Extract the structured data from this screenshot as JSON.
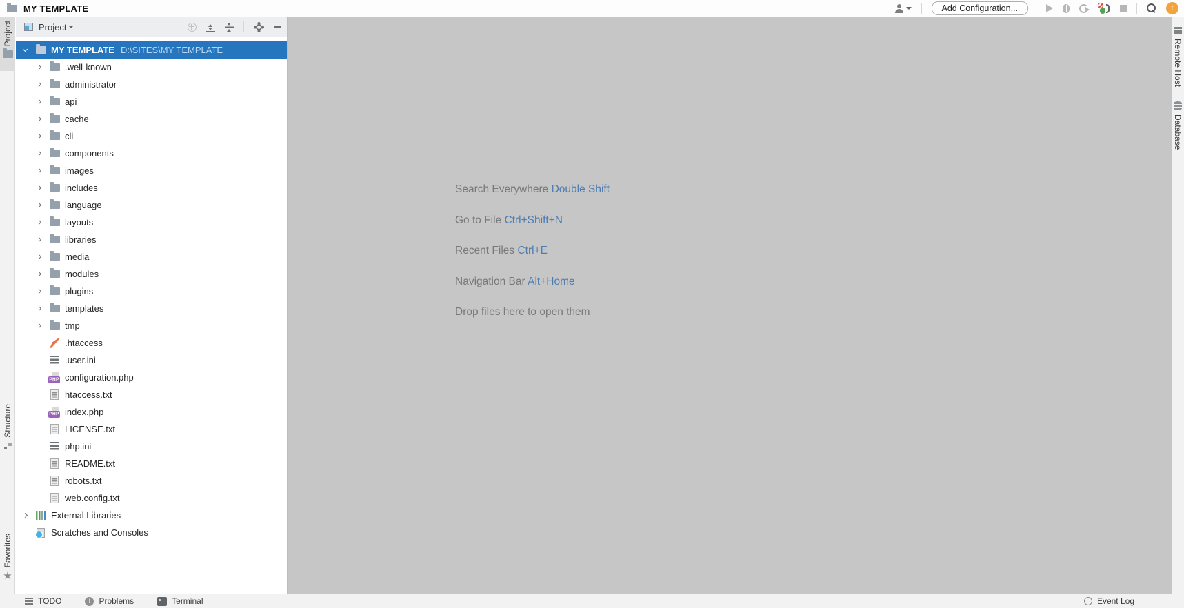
{
  "titlebar": {
    "title": "MY TEMPLATE",
    "add_configuration_label": "Add Configuration..."
  },
  "project_panel": {
    "tab_title": "Project",
    "root": {
      "name": "MY TEMPLATE",
      "path": "D:\\SITES\\MY TEMPLATE"
    },
    "items": [
      {
        "name": ".well-known",
        "icon": "folder",
        "chevron": true,
        "level": 2
      },
      {
        "name": "administrator",
        "icon": "folder",
        "chevron": true,
        "level": 2
      },
      {
        "name": "api",
        "icon": "folder",
        "chevron": true,
        "level": 2
      },
      {
        "name": "cache",
        "icon": "folder",
        "chevron": true,
        "level": 2
      },
      {
        "name": "cli",
        "icon": "folder",
        "chevron": true,
        "level": 2
      },
      {
        "name": "components",
        "icon": "folder",
        "chevron": true,
        "level": 2
      },
      {
        "name": "images",
        "icon": "folder",
        "chevron": true,
        "level": 2
      },
      {
        "name": "includes",
        "icon": "folder",
        "chevron": true,
        "level": 2
      },
      {
        "name": "language",
        "icon": "folder",
        "chevron": true,
        "level": 2
      },
      {
        "name": "layouts",
        "icon": "folder",
        "chevron": true,
        "level": 2
      },
      {
        "name": "libraries",
        "icon": "folder",
        "chevron": true,
        "level": 2
      },
      {
        "name": "media",
        "icon": "folder",
        "chevron": true,
        "level": 2
      },
      {
        "name": "modules",
        "icon": "folder",
        "chevron": true,
        "level": 2
      },
      {
        "name": "plugins",
        "icon": "folder",
        "chevron": true,
        "level": 2
      },
      {
        "name": "templates",
        "icon": "folder",
        "chevron": true,
        "level": 2
      },
      {
        "name": "tmp",
        "icon": "folder",
        "chevron": true,
        "level": 2
      },
      {
        "name": ".htaccess",
        "icon": "apache",
        "chevron": false,
        "level": 2
      },
      {
        "name": ".user.ini",
        "icon": "ini",
        "chevron": false,
        "level": 2
      },
      {
        "name": "configuration.php",
        "icon": "php",
        "chevron": false,
        "level": 2
      },
      {
        "name": "htaccess.txt",
        "icon": "text",
        "chevron": false,
        "level": 2
      },
      {
        "name": "index.php",
        "icon": "php",
        "chevron": false,
        "level": 2
      },
      {
        "name": "LICENSE.txt",
        "icon": "text",
        "chevron": false,
        "level": 2
      },
      {
        "name": "php.ini",
        "icon": "ini",
        "chevron": false,
        "level": 2
      },
      {
        "name": "README.txt",
        "icon": "text",
        "chevron": false,
        "level": 2
      },
      {
        "name": "robots.txt",
        "icon": "text",
        "chevron": false,
        "level": 2
      },
      {
        "name": "web.config.txt",
        "icon": "text",
        "chevron": false,
        "level": 2
      },
      {
        "name": "External Libraries",
        "icon": "extlib",
        "chevron": true,
        "level": 1
      },
      {
        "name": "Scratches and Consoles",
        "icon": "scratch",
        "chevron": false,
        "level": 1
      }
    ]
  },
  "editor_hints": {
    "lines": [
      {
        "label": "Search Everywhere",
        "shortcut": "Double Shift"
      },
      {
        "label": "Go to File",
        "shortcut": "Ctrl+Shift+N"
      },
      {
        "label": "Recent Files",
        "shortcut": "Ctrl+E"
      },
      {
        "label": "Navigation Bar",
        "shortcut": "Alt+Home"
      },
      {
        "label": "Drop files here to open them",
        "shortcut": ""
      }
    ]
  },
  "left_stripe": {
    "project_label": "Project",
    "structure_label": "Structure",
    "favorites_label": "Favorites"
  },
  "right_stripe": {
    "remote_host_label": "Remote Host",
    "database_label": "Database"
  },
  "status_bar": {
    "left": [
      {
        "label": "TODO",
        "icon": "todo"
      },
      {
        "label": "Problems",
        "icon": "problems"
      },
      {
        "label": "Terminal",
        "icon": "terminal"
      }
    ],
    "right": [
      {
        "label": "Event Log",
        "icon": "event-log"
      }
    ]
  },
  "icons": {
    "php_badge": "PHP",
    "terminal_glyph": ">_",
    "problems_glyph": "!",
    "update_glyph": "↑",
    "star_glyph": "★"
  },
  "colors": {
    "selection_blue": "#2675bf",
    "hint_label_gray": "#78797a",
    "hint_shortcut_blue": "#4d7db1",
    "update_orange": "#f2a33c",
    "editor_gray": "#c6c6c6"
  }
}
